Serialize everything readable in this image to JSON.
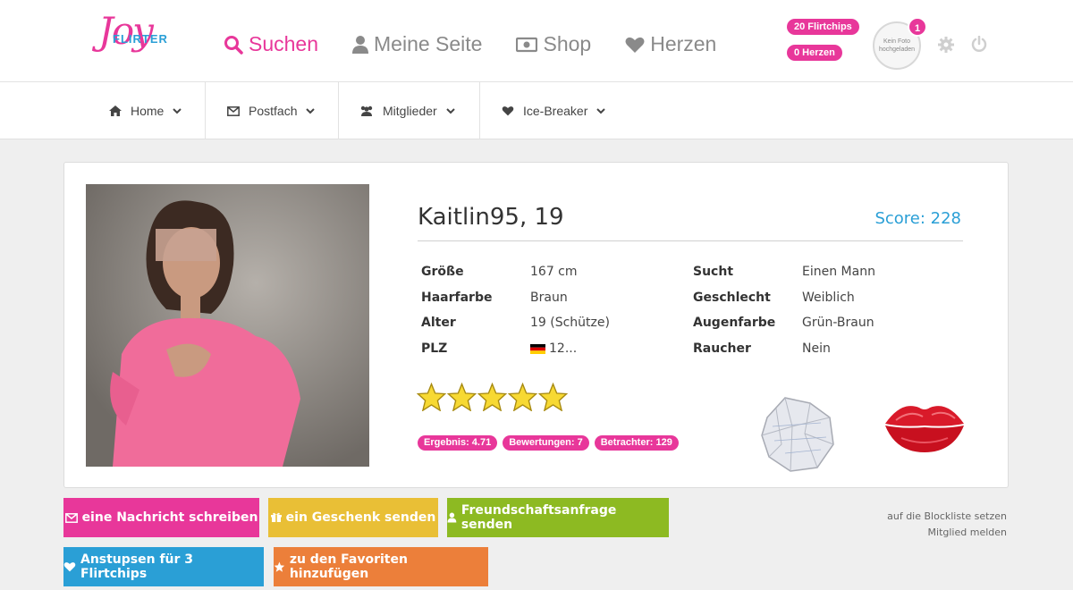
{
  "logo": {
    "joy": "Joy",
    "flirter": "FLIRTER"
  },
  "nav": {
    "search": "Suchen",
    "my_page": "Meine Seite",
    "shop": "Shop",
    "hearts": "Herzen"
  },
  "account": {
    "flirtchips": "20 Flirtchips",
    "hearts": "0 Herzen",
    "avatar_text": "Kein Foto hochgeladen",
    "notifications": "1"
  },
  "subnav": [
    {
      "label": "Home"
    },
    {
      "label": "Postfach"
    },
    {
      "label": "Mitglieder"
    },
    {
      "label": "Ice-Breaker"
    }
  ],
  "profile": {
    "name_age": "Kaitlin95, 19",
    "score": "Score: 228",
    "left_attrs": [
      {
        "label": "Größe",
        "value": "167 cm"
      },
      {
        "label": "Haarfarbe",
        "value": "Braun"
      },
      {
        "label": "Alter",
        "value": "19 (Schütze)"
      },
      {
        "label": "PLZ",
        "value": "12..."
      }
    ],
    "right_attrs": [
      {
        "label": "Sucht",
        "value": "Einen Mann"
      },
      {
        "label": "Geschlecht",
        "value": "Weiblich"
      },
      {
        "label": "Augenfarbe",
        "value": "Grün-Braun"
      },
      {
        "label": "Raucher",
        "value": "Nein"
      }
    ],
    "rating": 5,
    "rating_max": 5,
    "stats": [
      {
        "label": "Ergebnis: 4.71"
      },
      {
        "label": "Bewertungen: 7"
      },
      {
        "label": "Betrachter: 129"
      }
    ]
  },
  "actions": {
    "message": "eine Nachricht schreiben",
    "gift": "ein Geschenk senden",
    "friend": "Freundschaftsanfrage senden",
    "poke": "Anstupsen für 3 Flirtchips",
    "favorite": "zu den Favoriten hinzufügen",
    "blocklist": "auf die Blockliste setzen",
    "report": "Mitglied melden"
  },
  "colors": {
    "brand_pink": "#e8379a",
    "brand_blue": "#2a9fd6",
    "btn_message": "#e8379a",
    "btn_gift": "#e9bf36",
    "btn_friend": "#8dba22",
    "btn_poke": "#2a9fd6",
    "btn_favorite": "#ec7f3a"
  }
}
